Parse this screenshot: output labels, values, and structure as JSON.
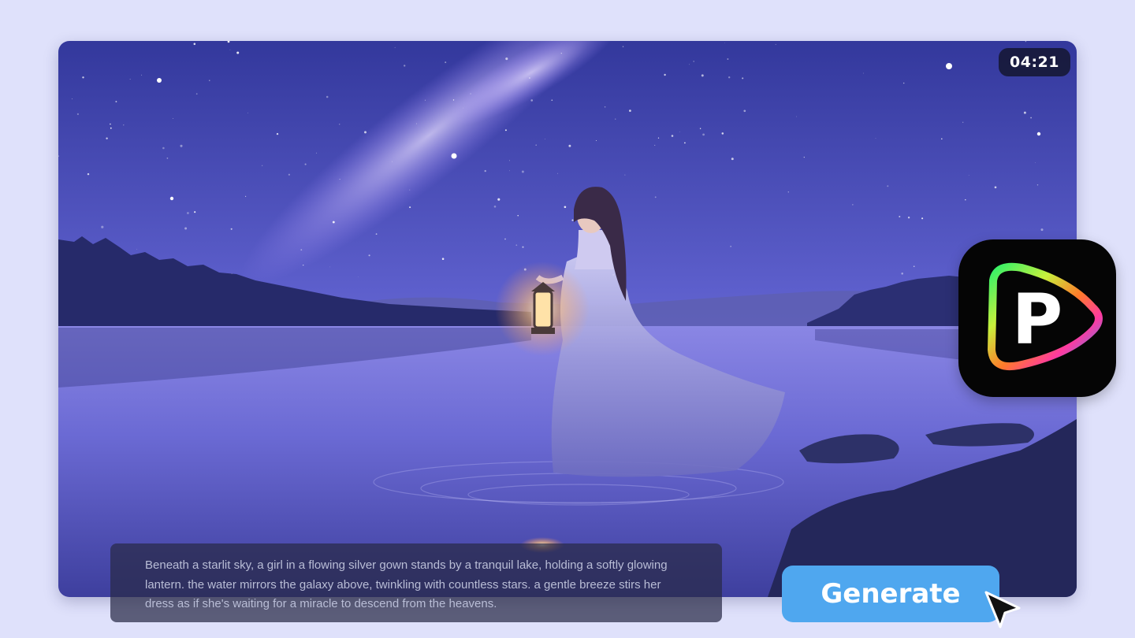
{
  "video": {
    "timestamp": "04:21",
    "scene": "starry-lake-girl-with-lantern"
  },
  "app_icon": {
    "glyph": "P",
    "icon": "app-logo-p-icon"
  },
  "prompt": {
    "text": "Beneath a starlit sky, a girl in a flowing silver gown stands by a tranquil lake, holding a softly glowing lantern. the water mirrors the galaxy above, twinkling with countless stars. a gentle breeze stirs her dress as if she's waiting for a miracle to descend from the heavens."
  },
  "actions": {
    "generate_label": "Generate"
  },
  "colors": {
    "page_bg": "#dfe1fb",
    "button": "#4fa7ef",
    "sky_top": "#3a3fa6",
    "lake": "#6e6fd6"
  },
  "cursor": {
    "icon": "mouse-pointer-icon"
  }
}
